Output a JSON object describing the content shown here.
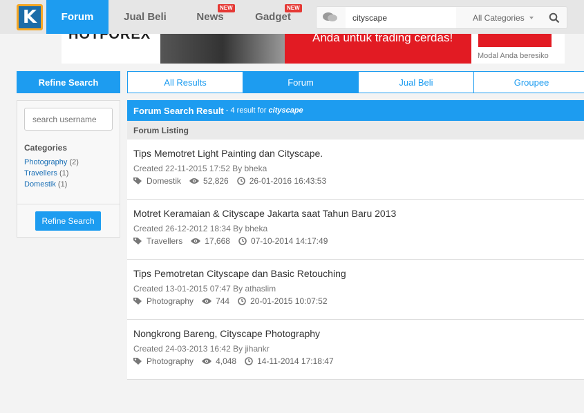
{
  "nav": {
    "logo": "K",
    "items": [
      {
        "label": "Forum",
        "active": true
      },
      {
        "label": "Jual Beli"
      },
      {
        "label": "News",
        "badge": "NEW"
      },
      {
        "label": "Gadget",
        "badge": "NEW"
      }
    ]
  },
  "search": {
    "value": "cityscape",
    "category": "All Categories"
  },
  "banner": {
    "brand": "HOTFOREX",
    "headline": "Anda untuk trading cerdas!",
    "disclaimer": "Modal Anda beresiko"
  },
  "sidebar": {
    "header": "Refine Search",
    "username_placeholder": "search username",
    "categories_title": "Categories",
    "categories": [
      {
        "name": "Photography",
        "count": "(2)"
      },
      {
        "name": "Travellers",
        "count": "(1)"
      },
      {
        "name": "Domestik",
        "count": "(1)"
      }
    ],
    "button": "Refine Search"
  },
  "tabs": [
    "All Results",
    "Forum",
    "Jual Beli",
    "Groupee"
  ],
  "active_tab": "Forum",
  "results": {
    "title": "Forum Search Result",
    "summary": "- 4 result for",
    "query": "cityscape",
    "listing_label": "Forum Listing",
    "items": [
      {
        "title": "Tips Memotret Light Painting dan Cityscape.",
        "created": "Created 22-11-2015 17:52 By bheka",
        "category": "Domestik",
        "views": "52,826",
        "last": "26-01-2016 16:43:53"
      },
      {
        "title": "Motret Keramaian & Cityscape Jakarta saat Tahun Baru 2013",
        "created": "Created 26-12-2012 18:34 By bheka",
        "category": "Travellers",
        "views": "17,668",
        "last": "07-10-2014 14:17:49"
      },
      {
        "title": "Tips Pemotretan Cityscape dan Basic Retouching",
        "created": "Created 13-01-2015 07:47 By athaslim",
        "category": "Photography",
        "views": "744",
        "last": "20-01-2015 10:07:52"
      },
      {
        "title": "Nongkrong Bareng, Cityscape Photography",
        "created": "Created 24-03-2013 16:42 By jihankr",
        "category": "Photography",
        "views": "4,048",
        "last": "14-11-2014 17:18:47"
      }
    ]
  },
  "colors": {
    "accent": "#1d9cf0",
    "badge": "#e53935",
    "logo_border": "#f5a623"
  }
}
